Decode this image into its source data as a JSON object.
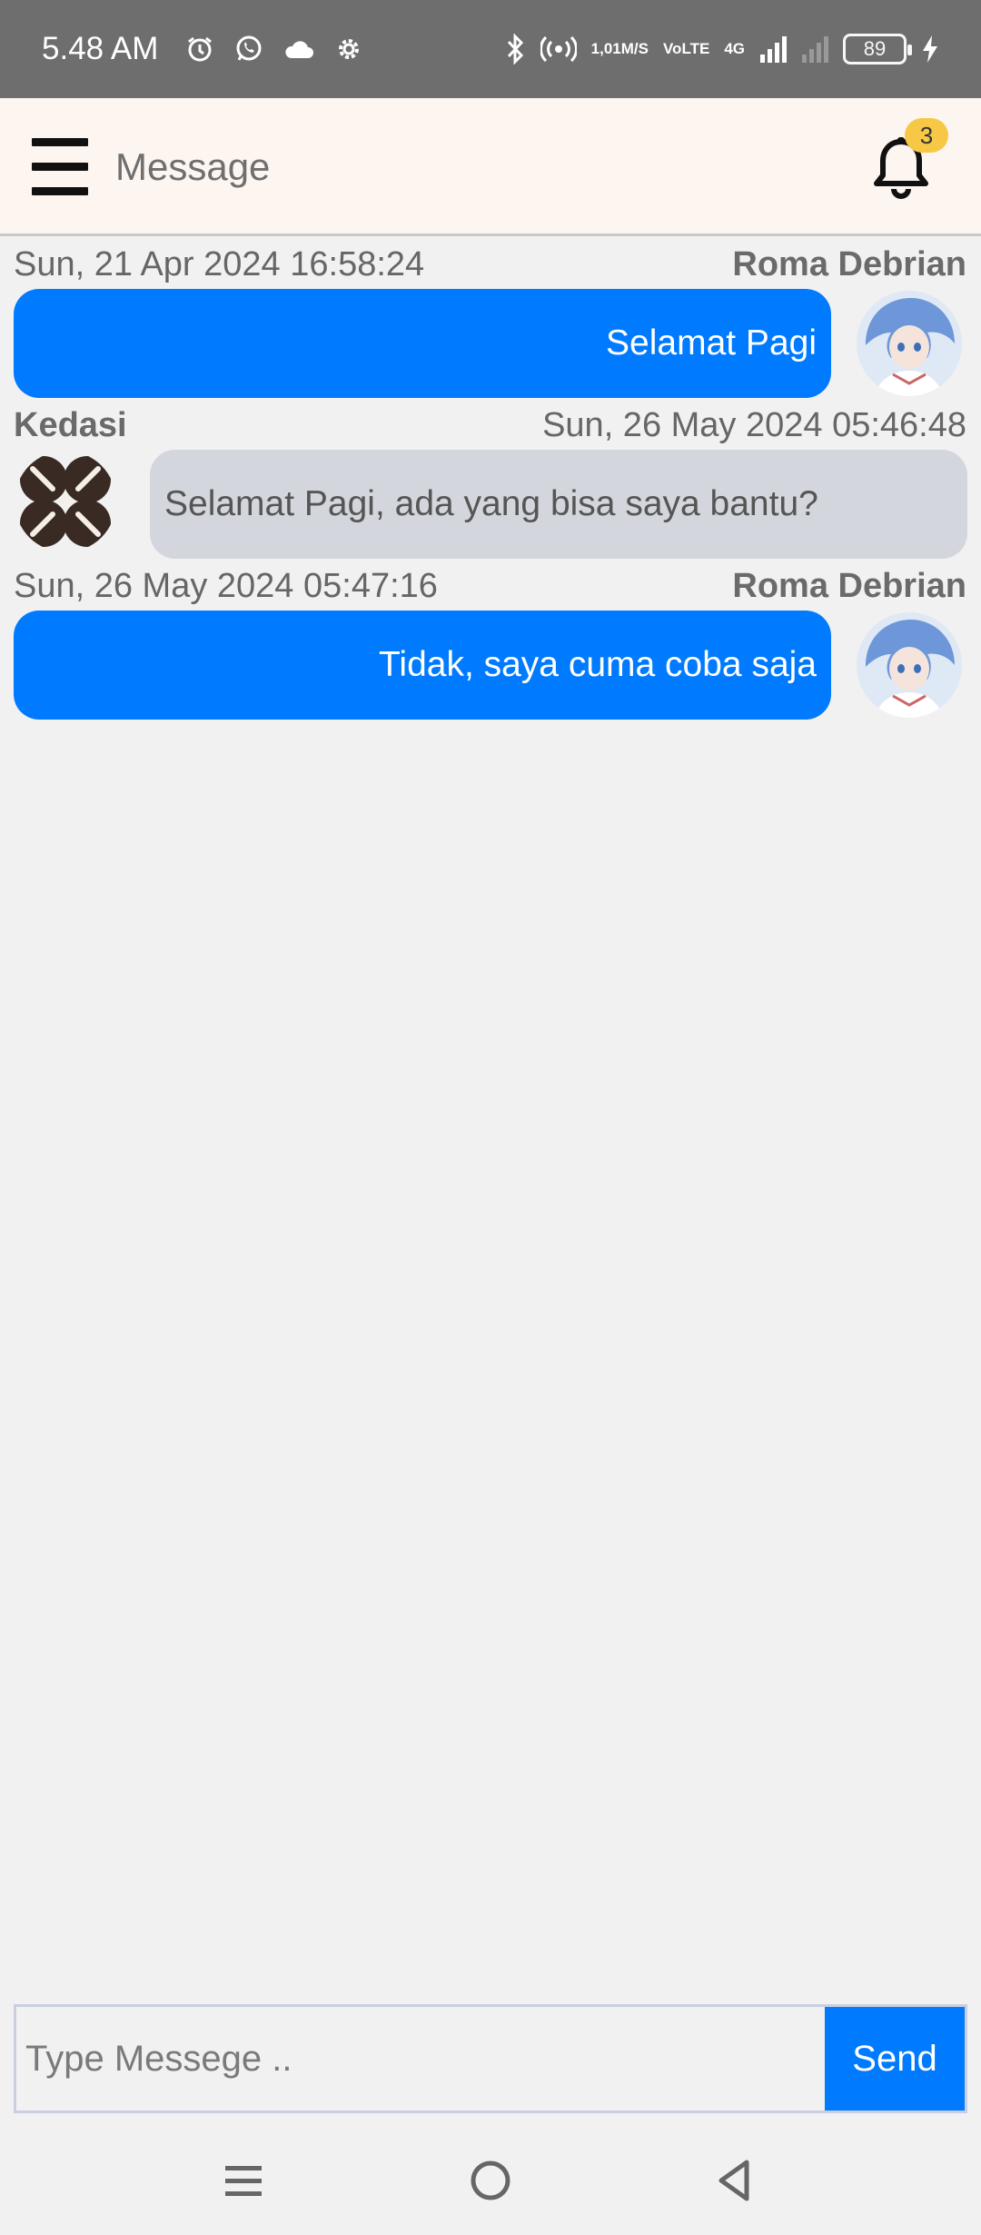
{
  "status_bar": {
    "time": "5.48 AM",
    "speed_top": "1,01",
    "speed_bottom": "M/S",
    "volte_top": "Vo",
    "volte_bottom": "LTE",
    "network": "4G",
    "battery": "89"
  },
  "header": {
    "title": "Message",
    "notification_count": "3"
  },
  "messages": [
    {
      "timestamp": "Sun, 21 Apr 2024 16:58:24",
      "sender": "Roma Debrian",
      "text": "Selamat Pagi",
      "direction": "outgoing"
    },
    {
      "timestamp": "Sun, 26 May 2024 05:46:48",
      "sender": "Kedasi",
      "text": "Selamat Pagi, ada yang bisa saya bantu?",
      "direction": "incoming"
    },
    {
      "timestamp": "Sun, 26 May 2024 05:47:16",
      "sender": "Roma Debrian",
      "text": "Tidak, saya cuma coba saja",
      "direction": "outgoing"
    }
  ],
  "composer": {
    "placeholder": "Type Messege ..",
    "send_label": "Send"
  },
  "colors": {
    "outgoing_bubble": "#007bff",
    "incoming_bubble": "#d4d6dd",
    "badge": "#f7c845",
    "header_bg": "#fdf5f0"
  }
}
